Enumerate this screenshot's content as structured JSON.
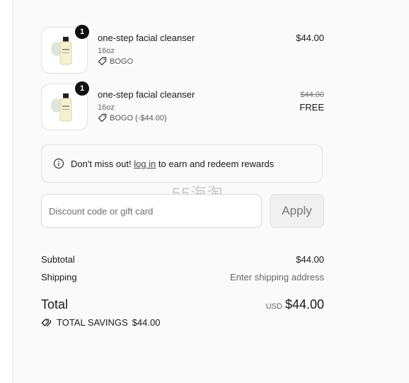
{
  "cart": {
    "items": [
      {
        "quantity": "1",
        "name": "one-step facial cleanser",
        "size": "16oz",
        "discount": "BOGO",
        "price": "$44.00"
      },
      {
        "quantity": "1",
        "name": "one-step facial cleanser",
        "size": "16oz",
        "discount": "BOGO (-$44.00)",
        "price_original": "$44.00",
        "price_final": "FREE"
      }
    ]
  },
  "rewards_notice": {
    "prefix": "Don't miss out!",
    "link": "log in",
    "suffix": "to earn and redeem rewards"
  },
  "watermark": "55海淘",
  "discount_code": {
    "placeholder": "Discount code or gift card",
    "apply_label": "Apply"
  },
  "summary": {
    "subtotal_label": "Subtotal",
    "subtotal_value": "$44.00",
    "shipping_label": "Shipping",
    "shipping_value": "Enter shipping address",
    "total_label": "Total",
    "currency": "USD",
    "total_value": "$44.00",
    "savings_label": "TOTAL SAVINGS",
    "savings_value": "$44.00"
  }
}
